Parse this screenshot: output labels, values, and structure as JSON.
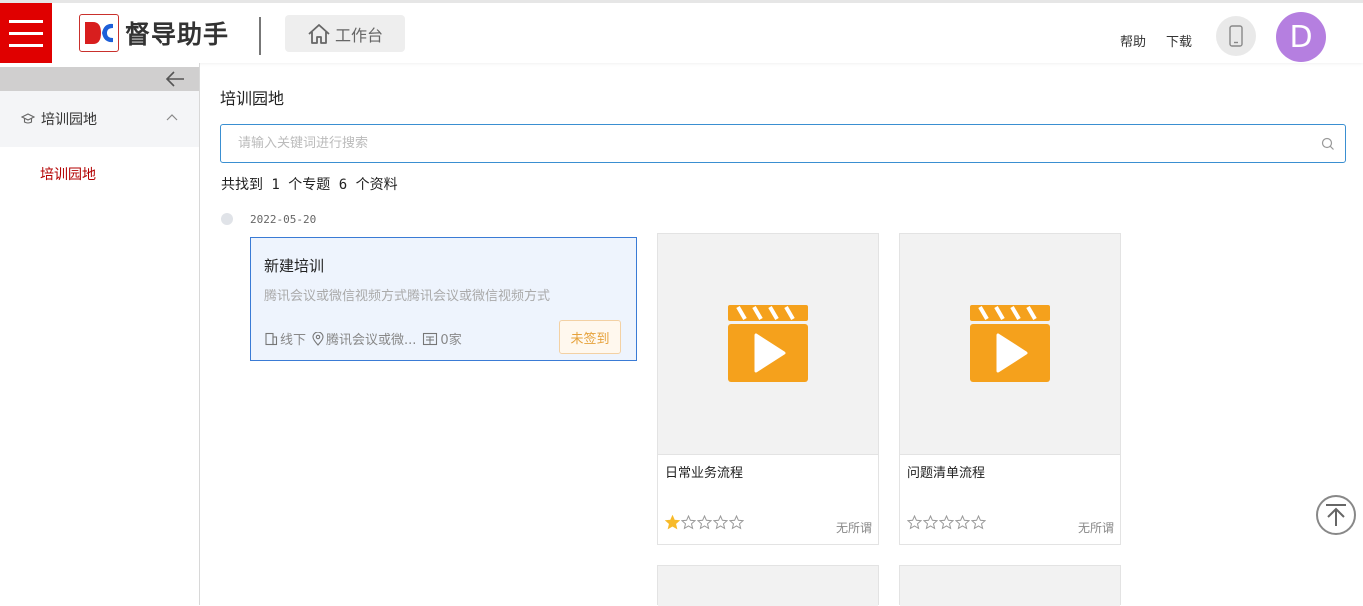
{
  "header": {
    "app_name": "督导助手",
    "workbench_label": "工作台",
    "help_label": "帮助",
    "download_label": "下载",
    "avatar_initial": "D",
    "brand_color": "#e00000",
    "avatar_color": "#b57fe0"
  },
  "sidebar": {
    "group_label": "培训园地",
    "items": [
      {
        "label": "培训园地",
        "active": true
      }
    ]
  },
  "main": {
    "title": "培训园地",
    "search_placeholder": "请输入关键词进行搜索",
    "result_count": "共找到 1 个专题 6 个资料",
    "timeline_date": "2022-05-20",
    "training": {
      "title": "新建培训",
      "description": "腾讯会议或微信视频方式腾讯会议或微信视频方式",
      "mode": "线下",
      "location": "腾讯会议或微...",
      "count": "0家",
      "sign_status": "未签到"
    },
    "resources": [
      {
        "title": "日常业务流程",
        "rating": 1,
        "max_rating": 5,
        "tag": "无所谓",
        "icon": "video-play-icon"
      },
      {
        "title": "问题清单流程",
        "rating": 0,
        "max_rating": 5,
        "tag": "无所谓",
        "icon": "video-play-icon"
      }
    ],
    "accent_color": "#3a8fd1",
    "video_icon_color": "#f5a11c"
  }
}
